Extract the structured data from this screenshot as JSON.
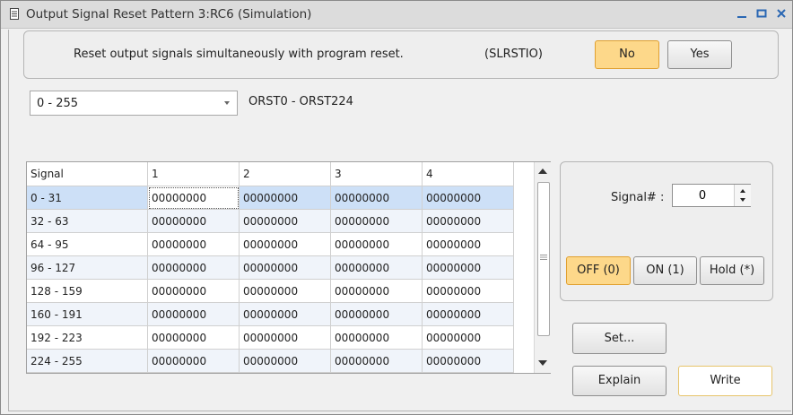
{
  "window": {
    "title": "Output Signal Reset Pattern 3:RC6  (Simulation)"
  },
  "reset_section": {
    "label": "Reset output signals simultaneously with program reset.",
    "variable": "(SLRSTIO)",
    "no_label": "No",
    "yes_label": "Yes",
    "selected": "No"
  },
  "range": {
    "selected": "0 - 255",
    "signal_range": "ORST0 - ORST224"
  },
  "grid": {
    "columns": [
      "Signal",
      "1",
      "2",
      "3",
      "4"
    ],
    "rows": [
      {
        "signal": " 0 -  31",
        "c1": "00000000",
        "c2": "00000000",
        "c3": "00000000",
        "c4": "00000000"
      },
      {
        "signal": " 32 -  63",
        "c1": "00000000",
        "c2": "00000000",
        "c3": "00000000",
        "c4": "00000000"
      },
      {
        "signal": " 64 -  95",
        "c1": "00000000",
        "c2": "00000000",
        "c3": "00000000",
        "c4": "00000000"
      },
      {
        "signal": " 96 - 127",
        "c1": "00000000",
        "c2": "00000000",
        "c3": "00000000",
        "c4": "00000000"
      },
      {
        "signal": "128 - 159",
        "c1": "00000000",
        "c2": "00000000",
        "c3": "00000000",
        "c4": "00000000"
      },
      {
        "signal": "160 - 191",
        "c1": "00000000",
        "c2": "00000000",
        "c3": "00000000",
        "c4": "00000000"
      },
      {
        "signal": "192 - 223",
        "c1": "00000000",
        "c2": "00000000",
        "c3": "00000000",
        "c4": "00000000"
      },
      {
        "signal": "224 - 255",
        "c1": "00000000",
        "c2": "00000000",
        "c3": "00000000",
        "c4": "00000000"
      }
    ]
  },
  "signal_panel": {
    "label": "Signal# :",
    "value": "0",
    "off_label": "OFF (0)",
    "on_label": "ON (1)",
    "hold_label": "Hold (*)",
    "selected": "OFF (0)"
  },
  "actions": {
    "set_label": "Set...",
    "explain_label": "Explain",
    "write_label": "Write"
  },
  "colors": {
    "highlight": "#fdd88a",
    "selection": "#cde0f7"
  }
}
